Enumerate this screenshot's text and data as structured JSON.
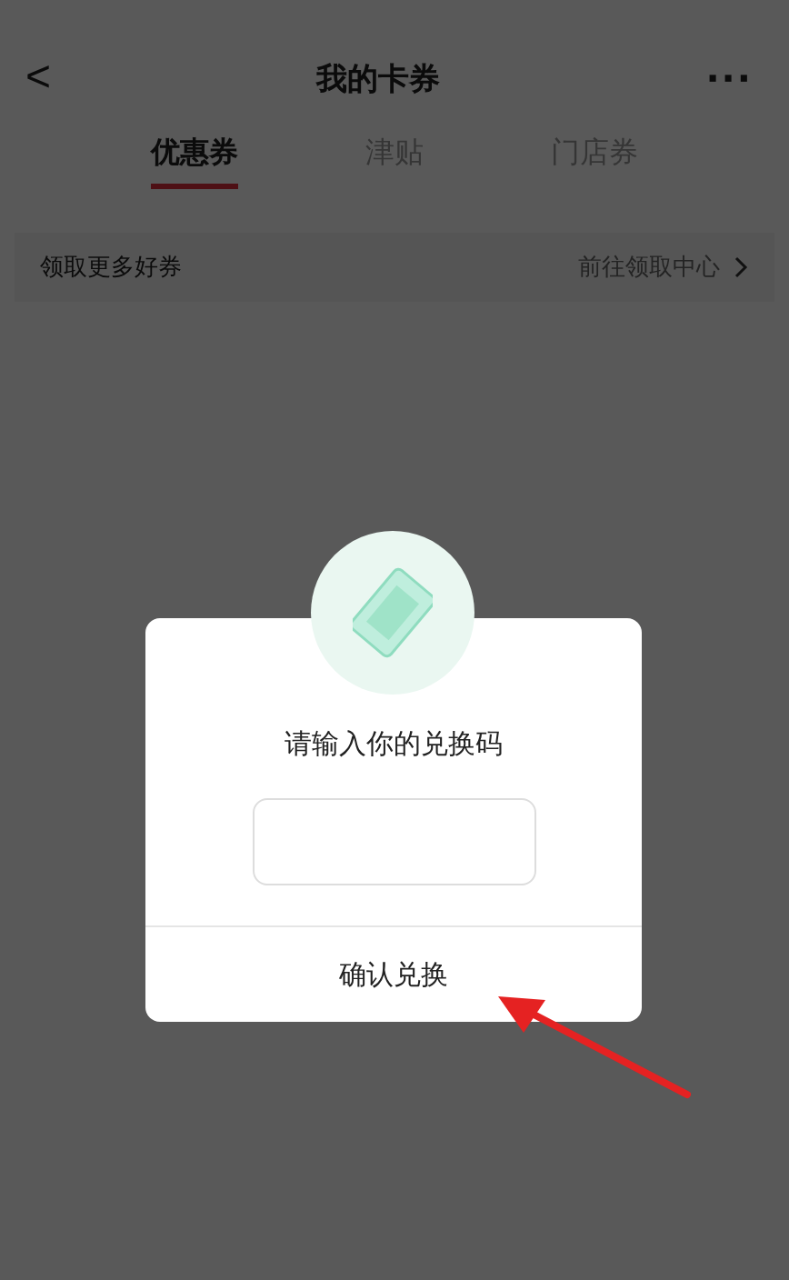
{
  "nav": {
    "back": "<",
    "title": "我的卡券",
    "more": "···"
  },
  "tabs": [
    {
      "label": "优惠券",
      "selected": true
    },
    {
      "label": "津贴",
      "selected": false
    },
    {
      "label": "门店券",
      "selected": false
    }
  ],
  "banner": {
    "text": "领取更多好券",
    "link": "前往领取中心"
  },
  "dialog": {
    "prompt": "请输入你的兑换码",
    "button": "确认兑换"
  }
}
